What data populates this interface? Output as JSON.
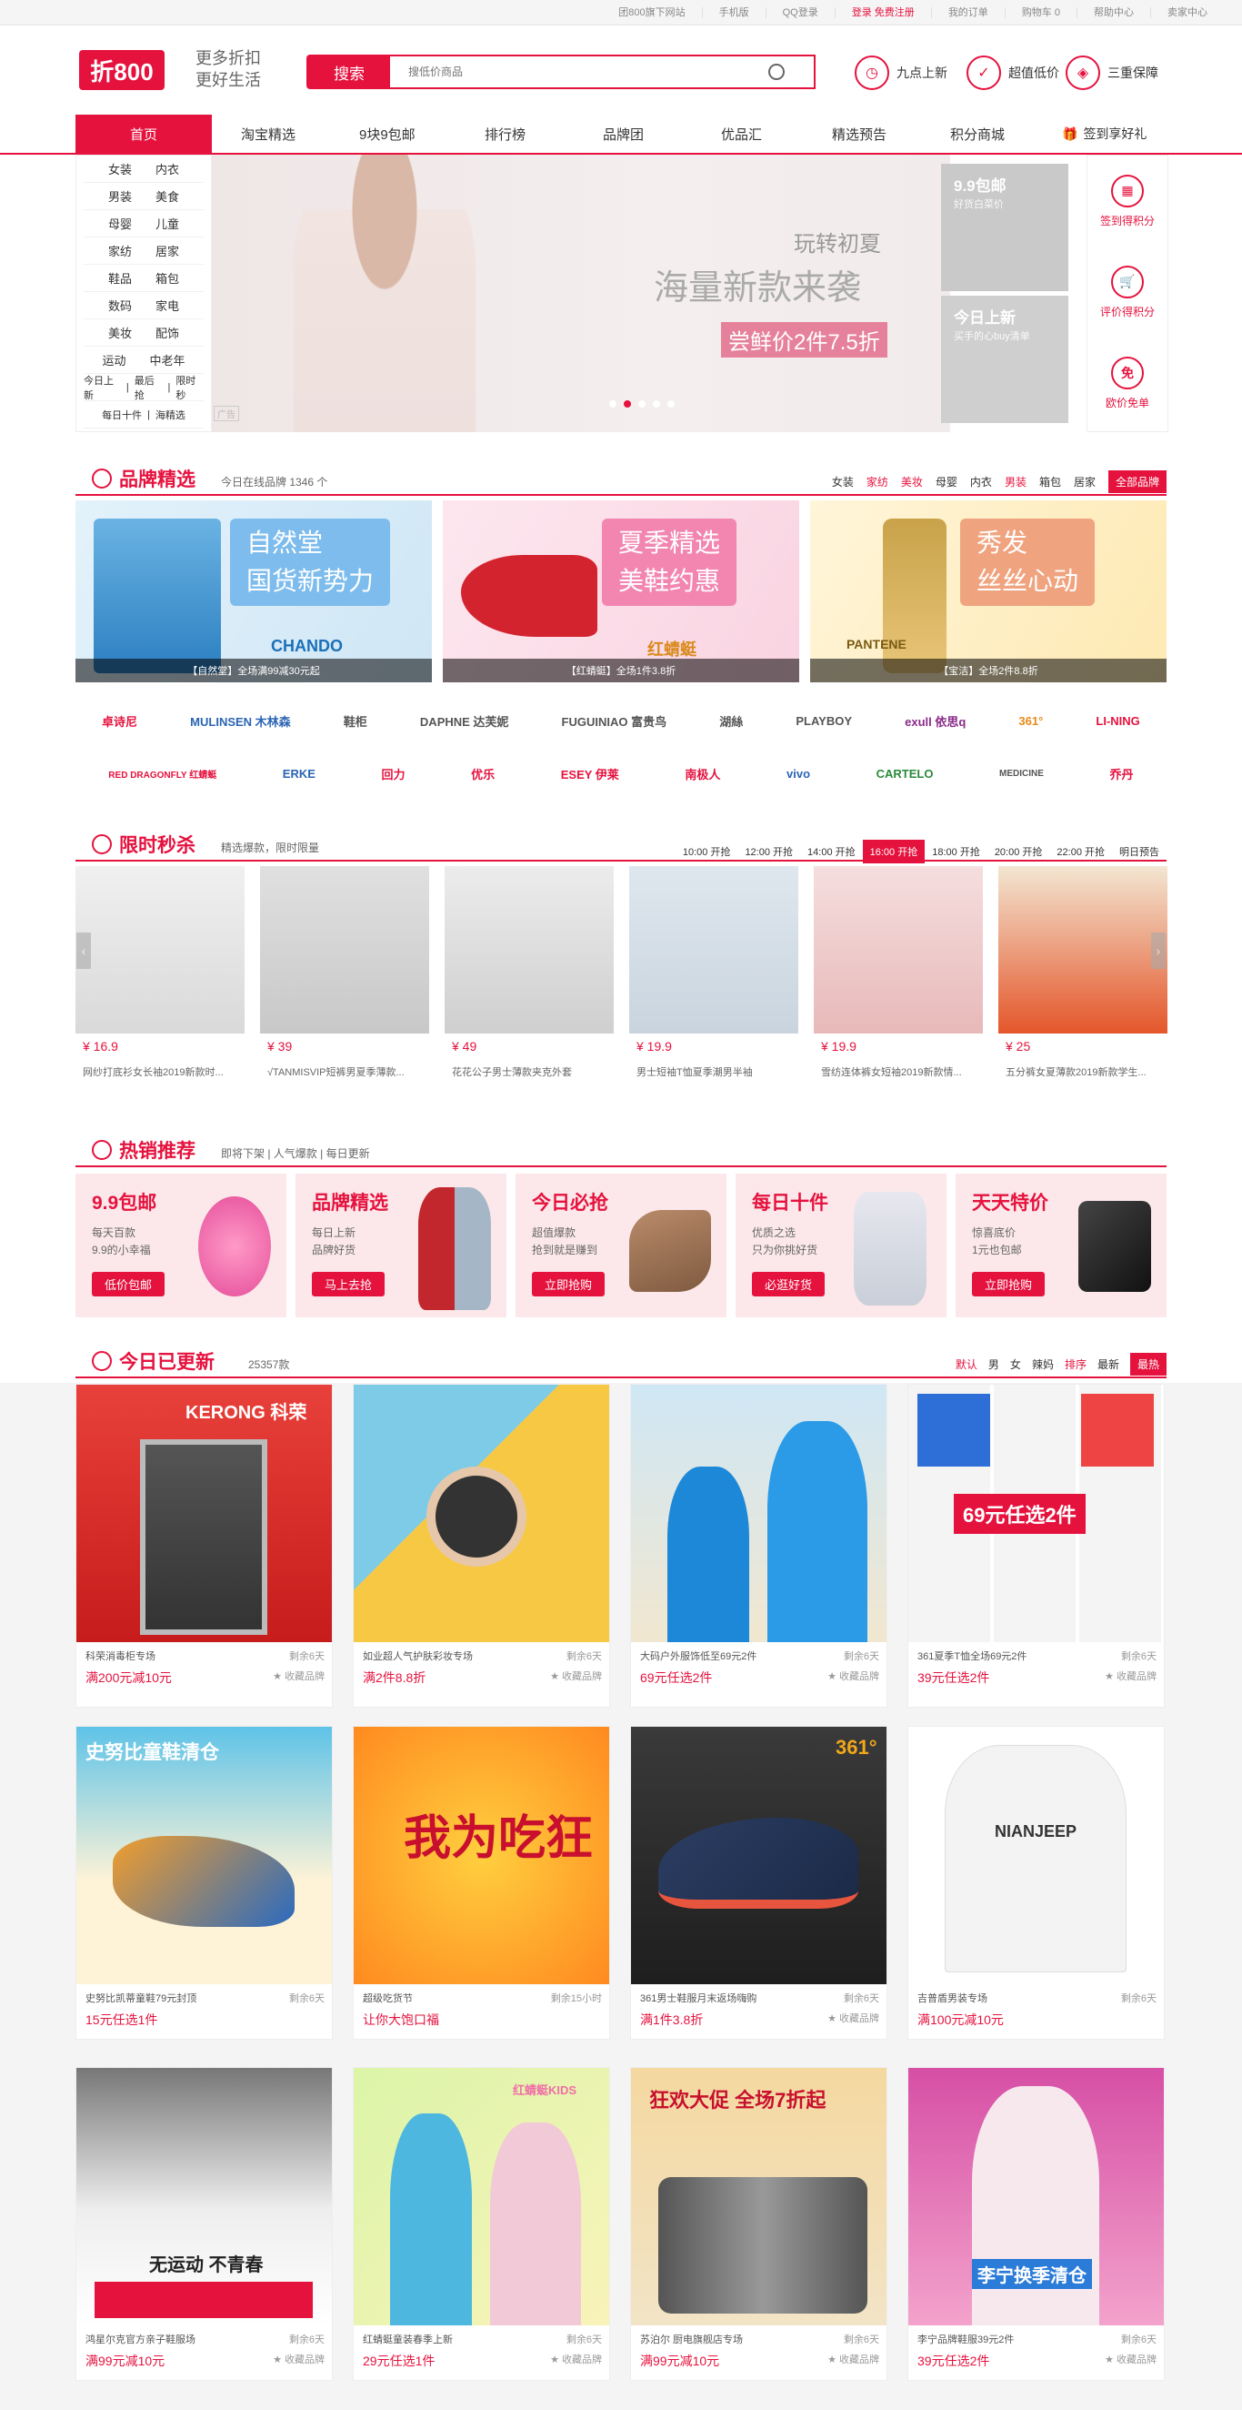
{
  "topbar": {
    "links": [
      "团800旗下网站",
      "手机版",
      "QQ登录",
      "登录 免费注册",
      "我的订单",
      "购物车 0",
      "帮助中心",
      "卖家中心"
    ]
  },
  "header": {
    "logo": "折800",
    "slogan1": "更多折扣",
    "slogan2": "更好生活",
    "search_btn": "搜索",
    "search_placeholder": "搜低价商品",
    "features": [
      {
        "icon": "clock-icon",
        "label": "九点上新"
      },
      {
        "icon": "thumb-icon",
        "label": "超值低价"
      },
      {
        "icon": "shield-icon",
        "label": "三重保障"
      }
    ]
  },
  "nav": {
    "items": [
      "首页",
      "淘宝精选",
      "9块9包邮",
      "排行榜",
      "品牌团",
      "优品汇",
      "精选预告",
      "积分商城"
    ],
    "gift": "签到享好礼"
  },
  "categories": [
    [
      "女装",
      "内衣"
    ],
    [
      "男装",
      "美食"
    ],
    [
      "母婴",
      "儿童"
    ],
    [
      "家纺",
      "居家"
    ],
    [
      "鞋品",
      "箱包"
    ],
    [
      "数码",
      "家电"
    ],
    [
      "美妆",
      "配饰"
    ],
    [
      "运动",
      "中老年"
    ]
  ],
  "cat_links": [
    "今日上新",
    "最后抢",
    "限时秒"
  ],
  "cat_links2": [
    "每日十件",
    "海精选"
  ],
  "banner": {
    "t1": "玩转初夏",
    "t2": "海量新款来袭",
    "t3": "尝鲜价2件7.5折",
    "tag": "广告"
  },
  "promos": [
    {
      "title": "9.9包邮",
      "sub": "好货白菜价"
    },
    {
      "title": "今日上新",
      "sub": "买手的心buy清单"
    }
  ],
  "side": [
    {
      "icon": "calendar-icon",
      "label": "签到得积分"
    },
    {
      "icon": "cart-icon",
      "label": "评价得积分"
    },
    {
      "icon": "free-icon",
      "label": "欧价免单"
    }
  ],
  "brand_section": {
    "title": "品牌精选",
    "sub": "今日在线品牌 1346 个",
    "tabs": [
      "女装",
      "家纺",
      "美妆",
      "母婴",
      "内衣",
      "男装",
      "箱包",
      "居家"
    ],
    "all": "全部品牌",
    "banners": [
      {
        "big1": "自然堂",
        "big2": "国货新势力",
        "brand": "CHANDO",
        "cap": "【自然堂】全场满99减30元起"
      },
      {
        "big1": "夏季精选",
        "big2": "美鞋约惠",
        "brand": "红蜻蜓",
        "cap": "【红蜻蜓】全场1件3.8折"
      },
      {
        "big1": "秀发",
        "big2": "丝丝心动",
        "brand": "PANTENE",
        "cap": "【宝洁】全场2件8.8折"
      }
    ],
    "logos1": [
      "卓诗尼",
      "MULINSEN 木林森",
      "鞋柜",
      "DAPHNE 达芙妮",
      "FUGUINIAO 富贵鸟",
      "湖絲",
      "PLAYBOY",
      "exull 依思q",
      "361°",
      "LI-NING"
    ],
    "logos2": [
      "RED DRAGONFLY 红蜻蜓",
      "ERKE",
      "回力",
      "优乐",
      "ESEY 伊莱",
      "南极人",
      "vivo",
      "CARTELO",
      "MEDICINE",
      "乔丹"
    ]
  },
  "flash_section": {
    "title": "限时秒杀",
    "sub": "精选爆款，限时限量",
    "times": [
      "10:00 开抢",
      "12:00 开抢",
      "14:00 开抢",
      "16:00 开抢",
      "18:00 开抢",
      "20:00 开抢",
      "22:00 开抢",
      "明日预告"
    ],
    "items": [
      {
        "price": "¥ 16.9",
        "name": "网纱打底衫女长袖2019新款时..."
      },
      {
        "price": "¥ 39",
        "name": "√TANMISVIP短裤男夏季薄款..."
      },
      {
        "price": "¥ 49",
        "name": "花花公子男士薄款夹克外套"
      },
      {
        "price": "¥ 19.9",
        "name": "男士短袖T恤夏季潮男半袖"
      },
      {
        "price": "¥ 19.9",
        "name": "雪纺连体裤女短袖2019新款情..."
      },
      {
        "price": "¥ 25",
        "name": "五分裤女夏薄款2019新款学生..."
      }
    ]
  },
  "hot_section": {
    "title": "热销推荐",
    "sub": "即将下架 | 人气爆款 | 每日更新",
    "cards": [
      {
        "title": "9.9包邮",
        "s1": "每天百款",
        "s2": "9.9的小幸福",
        "btn": "低价包邮"
      },
      {
        "title": "品牌精选",
        "s1": "每日上新",
        "s2": "品牌好货",
        "btn": "马上去抢"
      },
      {
        "title": "今日必抢",
        "s1": "超值爆款",
        "s2": "抢到就是赚到",
        "btn": "立即抢购"
      },
      {
        "title": "每日十件",
        "s1": "优质之选",
        "s2": "只为你挑好货",
        "btn": "必逛好货"
      },
      {
        "title": "天天特价",
        "s1": "惊喜底价",
        "s2": "1元也包邮",
        "btn": "立即抢购"
      }
    ]
  },
  "today_section": {
    "title": "今日已更新",
    "sub": "25357款",
    "tabs": [
      "默认",
      "男",
      "女",
      "辣妈",
      "排序",
      "最新",
      "最热"
    ],
    "cards": [
      {
        "name": "科荣消毒柜专场",
        "left": "剩余6天",
        "price": "满200元减10元",
        "fav": "收藏品牌",
        "label": "KERONG 科荣"
      },
      {
        "name": "如业超人气护肤彩妆专场",
        "left": "剩余6天",
        "price": "满2件8.8折",
        "fav": "收藏品牌",
        "label": ""
      },
      {
        "name": "大码户外服饰低至69元2件",
        "left": "剩余6天",
        "price": "69元任选2件",
        "fav": "收藏品牌",
        "label": ""
      },
      {
        "name": "361夏季T恤全场69元2件",
        "left": "剩余6天",
        "price": "39元任选2件",
        "fav": "收藏品牌",
        "label": "69元任选2件"
      },
      {
        "name": "史努比凯蒂童鞋79元封顶",
        "left": "剩余6天",
        "price": "15元任选1件",
        "fav": "",
        "label": "史努比童鞋清仓"
      },
      {
        "name": "超级吃货节",
        "left": "剩余15小时",
        "price": "让你大饱口福",
        "fav": "",
        "label": "我为吃狂"
      },
      {
        "name": "361男士鞋服月末返场嗨购",
        "left": "剩余6天",
        "price": "满1件3.8折",
        "fav": "收藏品牌",
        "label": "361°"
      },
      {
        "name": "吉普盾男装专场",
        "left": "剩余6天",
        "price": "满100元减10元",
        "fav": "",
        "label": "NIANJEEP"
      },
      {
        "name": "鸿星尔克官方亲子鞋服场",
        "left": "剩余6天",
        "price": "满99元减10元",
        "fav": "收藏品牌",
        "label": "无运动 不青春"
      },
      {
        "name": "红蜻蜓童装春季上新",
        "left": "剩余6天",
        "price": "29元任选1件",
        "fav": "收藏品牌",
        "label": "红蜻蜓KIDS"
      },
      {
        "name": "苏泊尔 厨电旗舰店专场",
        "left": "剩余6天",
        "price": "满99元减10元",
        "fav": "收藏品牌",
        "label": "狂欢大促 全场7折起"
      },
      {
        "name": "李宁品牌鞋服39元2件",
        "left": "剩余6天",
        "price": "39元任选2件",
        "fav": "收藏品牌",
        "label": "李宁换季清仓"
      }
    ]
  }
}
